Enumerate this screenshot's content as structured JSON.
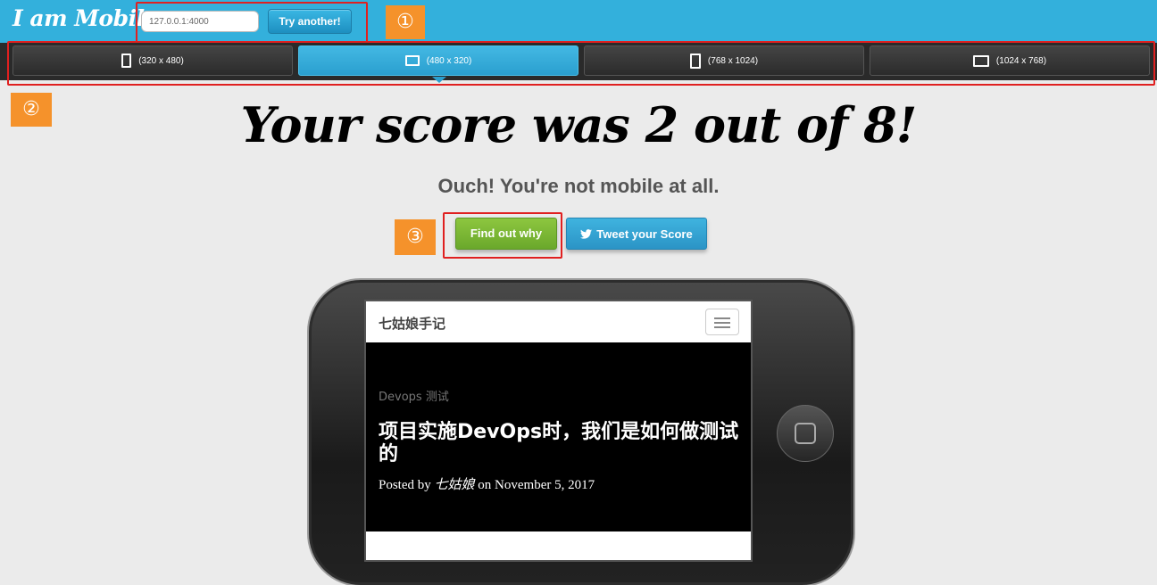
{
  "header": {
    "logo": "I am Mobile",
    "url_value": "127.0.0.1:4000",
    "try_button": "Try another!"
  },
  "annotations": [
    "①",
    "②",
    "③"
  ],
  "device_tabs": [
    {
      "label": "(320 x 480)",
      "orientation": "portrait",
      "active": false
    },
    {
      "label": "(480 x 320)",
      "orientation": "landscape",
      "active": true
    },
    {
      "label": "(768 x 1024)",
      "orientation": "portrait",
      "active": false
    },
    {
      "label": "(1024 x 768)",
      "orientation": "landscape",
      "active": false
    }
  ],
  "result": {
    "headline": "Your score was 2 out of 8!",
    "subline": "Ouch! You're not mobile at all.",
    "find_button": "Find out why",
    "tweet_button": "Tweet your Score"
  },
  "preview": {
    "site_title": "七姑娘手记",
    "category": "Devops 测试",
    "post_title": "项目实施DevOps时，我们是如何做测试的",
    "posted_by_prefix": "Posted by ",
    "author": "七姑娘",
    "posted_on": " on November 5, 2017"
  },
  "colors": {
    "topbar": "#33b0dc",
    "active_tab": "#2a9fcf",
    "annotation_box": "#e02020",
    "badge": "#f5922b",
    "find_button": "#8dc63f"
  }
}
